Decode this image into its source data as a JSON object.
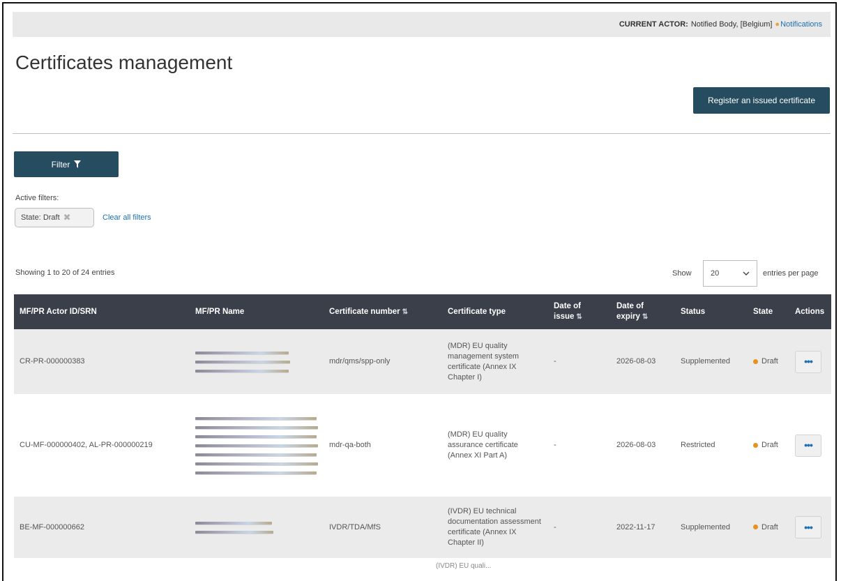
{
  "topbar": {
    "current_actor_label": "CURRENT ACTOR:",
    "actor_value": "Notified Body, [Belgium]",
    "notifications_label": "Notifications",
    "bell_icon": "bell-icon"
  },
  "page": {
    "title": "Certificates management"
  },
  "register_button": {
    "label": "Register an issued certificate"
  },
  "filter": {
    "button_label": "Filter",
    "icon": "funnel-icon",
    "active_filters_label": "Active filters:",
    "chip_key": "State:",
    "chip_value": "Draft",
    "clear_all_label": "Clear all filters"
  },
  "pagination": {
    "showing_text": "Showing 1 to 20 of 24 entries",
    "show_label": "Show",
    "per_page_value": "20",
    "entries_label": "entries per page"
  },
  "table": {
    "columns": [
      {
        "label": "MF/PR Actor ID/SRN",
        "sort_icon": ""
      },
      {
        "label": "MF/PR Name",
        "sort_icon": ""
      },
      {
        "label": "Certificate number",
        "sort_icon": "⇅"
      },
      {
        "label": "Certificate type",
        "sort_icon": ""
      },
      {
        "label": "Date of issue",
        "sort_icon": "⇅"
      },
      {
        "label": "Date of expiry",
        "sort_icon": "⇅"
      },
      {
        "label": "Status",
        "sort_icon": ""
      },
      {
        "label": "State",
        "sort_icon": ""
      },
      {
        "label": "Actions",
        "sort_icon": ""
      }
    ],
    "rows": [
      {
        "actor_id": "CR-PR-000000383",
        "certificate_number": "mdr/qms/spp-only",
        "certificate_type": "(MDR) EU quality management system certificate (Annex IX Chapter I)",
        "date_of_issue": "-",
        "date_of_expiry": "2026-08-03",
        "status": "Supplemented",
        "state": "Draft",
        "actions": "•••"
      },
      {
        "actor_id": "CU-MF-000000402, AL-PR-000000219",
        "certificate_number": "mdr-qa-both",
        "certificate_type": "(MDR) EU quality assurance certificate (Annex XI Part A)",
        "date_of_issue": "-",
        "date_of_expiry": "2026-08-03",
        "status": "Restricted",
        "state": "Draft",
        "actions": "•••"
      },
      {
        "actor_id": "BE-MF-000000662",
        "certificate_number": "IVDR/TDA/MfS",
        "certificate_type": "(IVDR) EU technical documentation assessment certificate (Annex IX Chapter II)",
        "date_of_issue": "-",
        "date_of_expiry": "2022-11-17",
        "status": "Supplemented",
        "state": "Draft",
        "actions": "•••"
      }
    ],
    "partial_next_row_text": "(IVDR) EU quali..."
  },
  "colors": {
    "primary_button": "#264c60",
    "table_header": "#3a3f4a",
    "link": "#1b6fb2",
    "state_draft_dot": "#e8911f"
  }
}
